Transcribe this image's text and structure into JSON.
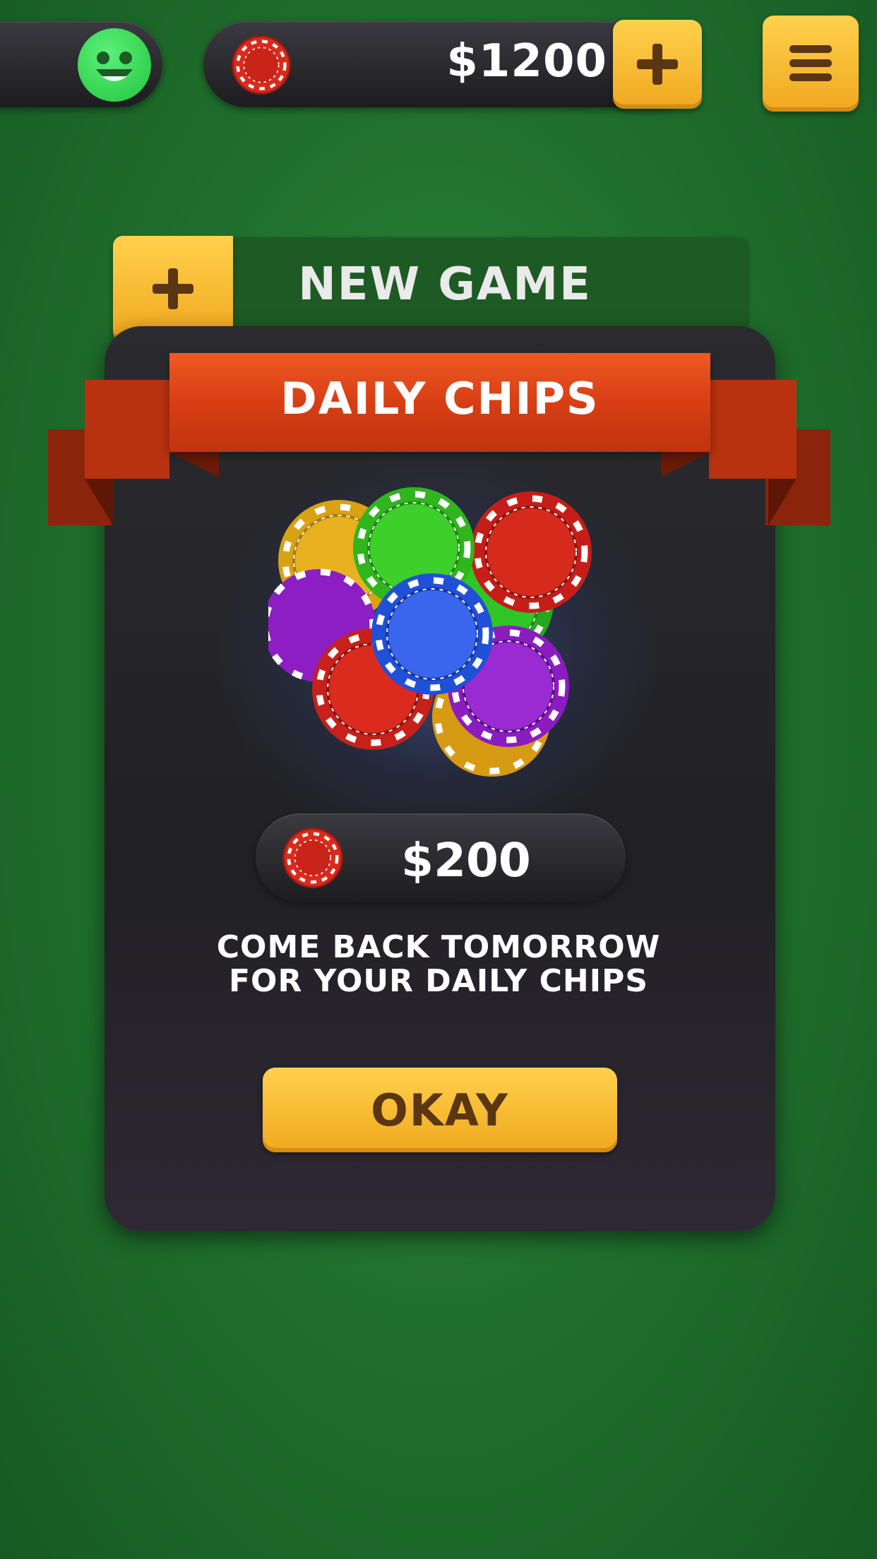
{
  "top_bar": {
    "balance": "$1200"
  },
  "new_game": {
    "label": "NEW GAME"
  },
  "dialog": {
    "title": "DAILY CHIPS",
    "prize": "$200",
    "message_line_1": "COME BACK TOMORROW",
    "message_line_2": "FOR YOUR DAILY CHIPS",
    "okay_label": "OKAY"
  },
  "icons": {
    "avatar": "smiley-face-icon",
    "chip": "poker-chip-icon",
    "add": "plus-icon",
    "menu": "hamburger-menu-icon",
    "chip_pile": "poker-chip-pile-image"
  },
  "colors": {
    "table_green": "#1f6e2c",
    "gold_button": "#f5b52a",
    "ribbon_red": "#d83e14",
    "panel_dark": "#222226",
    "avatar_green": "#3be25a"
  }
}
